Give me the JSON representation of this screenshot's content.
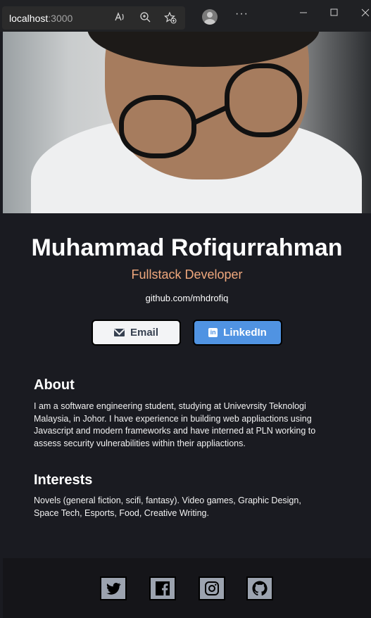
{
  "browser": {
    "host": "localhost",
    "port": ":3000",
    "more_label": "···"
  },
  "hero": {
    "image": "portrait-photo"
  },
  "profile": {
    "name": "Muhammad Rofiqurrahman",
    "role": "Fullstack Developer",
    "github": "github.com/mhdrofiq"
  },
  "buttons": {
    "email_label": "Email",
    "linkedin_label": "LinkedIn"
  },
  "about": {
    "heading": "About",
    "text": "I am a software engineering student, studying at Univevrsity Teknologi Malaysia, in Johor. I have experience in building web appliactions using Javascript and modern frameworks and have interned at PLN working to assess security vulnerabilities within their appliactions."
  },
  "interests": {
    "heading": "Interests",
    "text": "Novels (general fiction, scifi, fantasy). Video games, Graphic Design, Space Tech, Esports, Food, Creative Writing."
  },
  "footer": {
    "icons": [
      "twitter-icon",
      "facebook-icon",
      "instagram-icon",
      "github-icon"
    ]
  },
  "colors": {
    "background": "#1a1b21",
    "accent": "#f0a87d",
    "linkedin": "#5093e2",
    "footer": "#151519"
  }
}
